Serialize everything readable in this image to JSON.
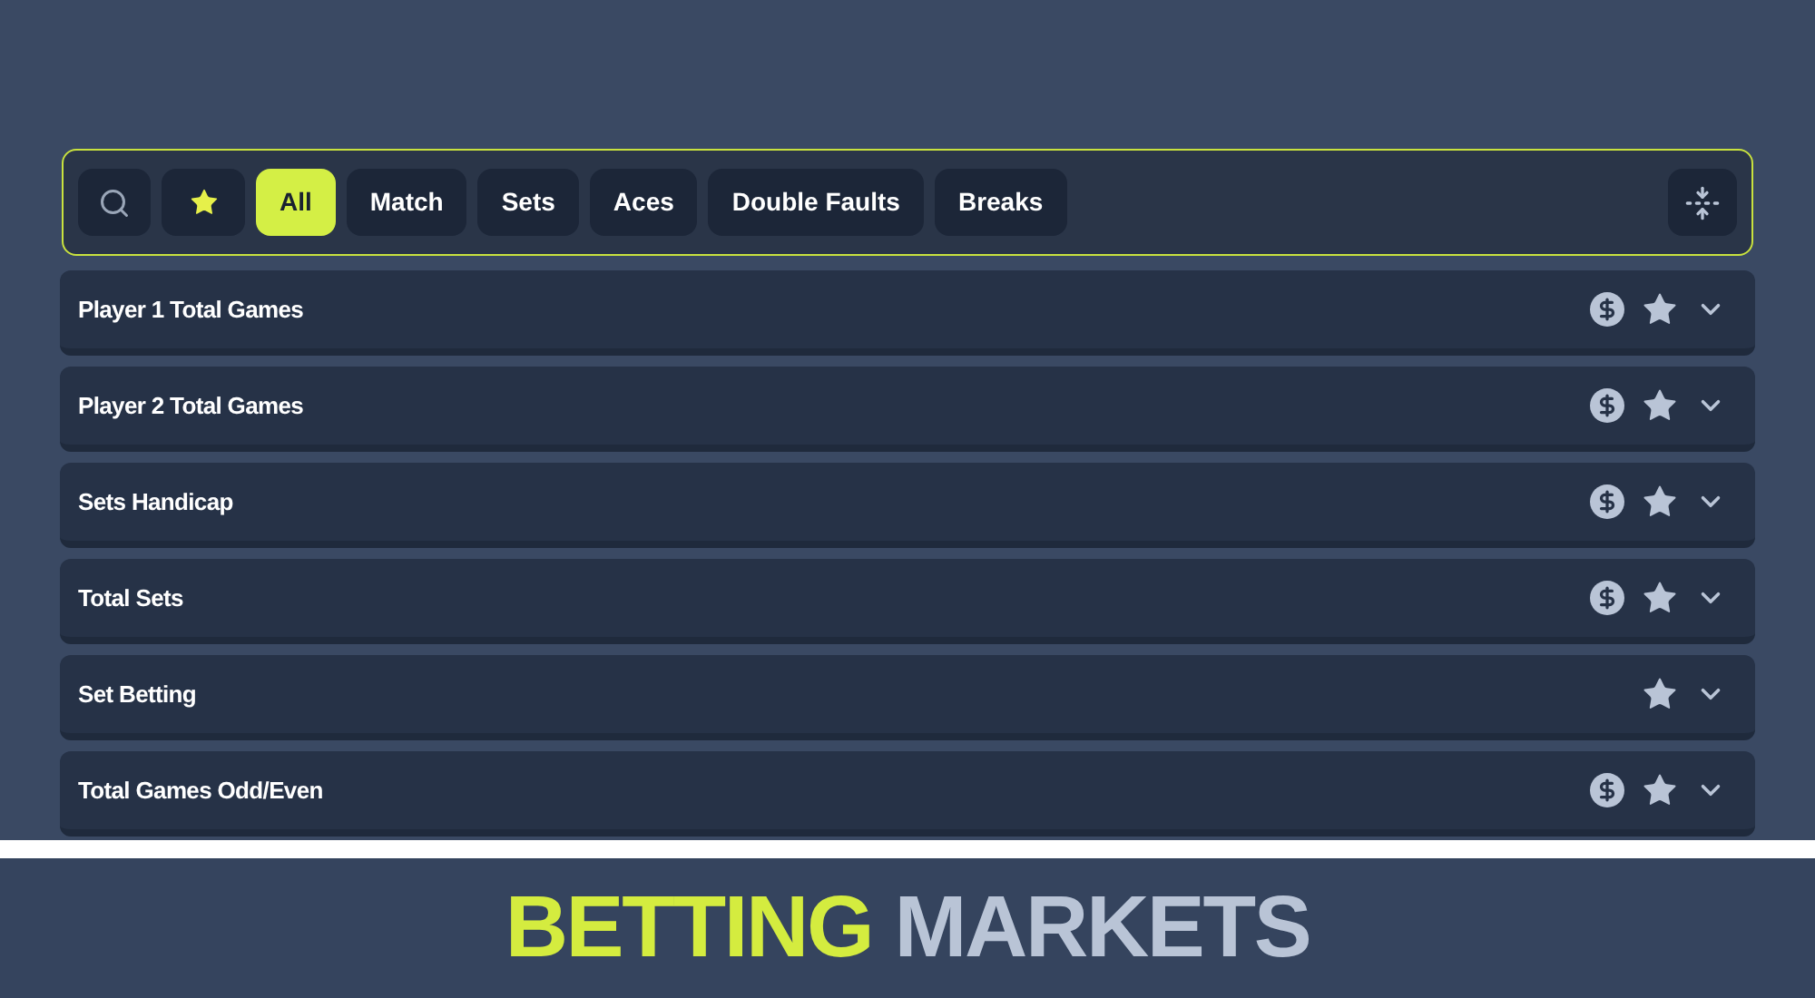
{
  "filters": [
    {
      "kind": "search",
      "selected": false
    },
    {
      "kind": "favourites",
      "selected": false
    },
    {
      "kind": "text",
      "label": "All",
      "selected": true
    },
    {
      "kind": "text",
      "label": "Match",
      "selected": false
    },
    {
      "kind": "text",
      "label": "Sets",
      "selected": false
    },
    {
      "kind": "text",
      "label": "Aces",
      "selected": false
    },
    {
      "kind": "text",
      "label": "Double Faults",
      "selected": false
    },
    {
      "kind": "text",
      "label": "Breaks",
      "selected": false
    }
  ],
  "markets": [
    {
      "name": "Player 1 Total Games",
      "cash_out": true
    },
    {
      "name": "Player 2 Total Games",
      "cash_out": true
    },
    {
      "name": "Sets Handicap",
      "cash_out": true
    },
    {
      "name": "Total Sets",
      "cash_out": true
    },
    {
      "name": "Set Betting",
      "cash_out": false
    },
    {
      "name": "Total Games Odd/Even",
      "cash_out": true
    }
  ],
  "banner": {
    "highlight": "BETTING",
    "rest": "MARKETS"
  }
}
